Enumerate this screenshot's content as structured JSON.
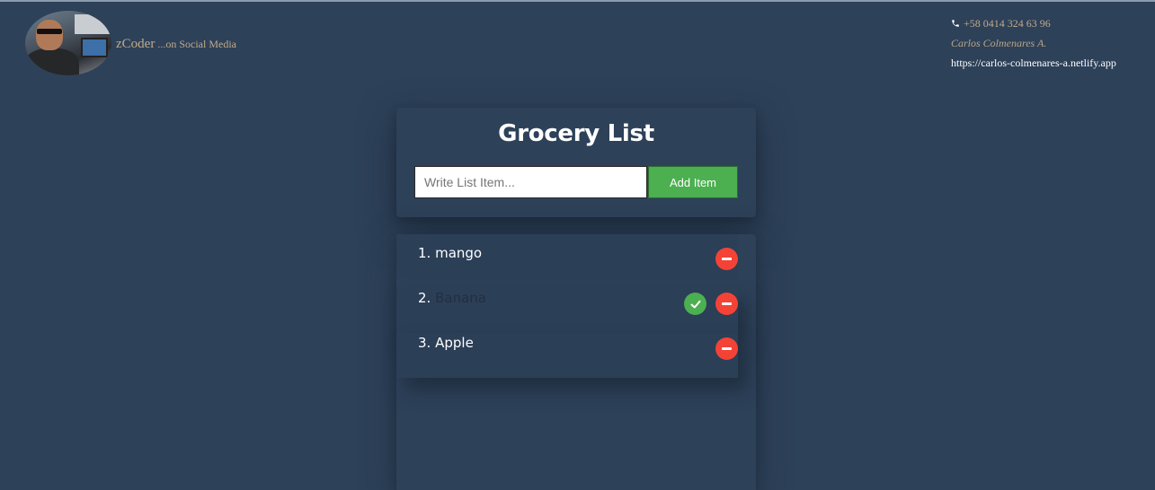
{
  "header": {
    "brand_name": "zCoder",
    "brand_tagline": " ...on Social Media",
    "phone": "+58 0414 324 63 96",
    "author": "Carlos Colmenares A.",
    "url": "https://carlos-colmenares-a.netlify.app"
  },
  "form": {
    "title": "Grocery List",
    "input_placeholder": "Write List Item...",
    "input_value": "",
    "add_button_label": "Add Item"
  },
  "items": [
    {
      "number": "1.",
      "label": "mango",
      "completed": false
    },
    {
      "number": "2.",
      "label": "Banana",
      "completed": true
    },
    {
      "number": "3.",
      "label": "Apple",
      "completed": false
    }
  ],
  "colors": {
    "background": "#2d4159",
    "accent_green": "#4caf50",
    "accent_red": "#f44336",
    "brand_text": "#c1ab8a"
  },
  "icons": {
    "phone": "phone-icon",
    "remove": "minus-circle-icon",
    "complete": "check-circle-icon"
  }
}
